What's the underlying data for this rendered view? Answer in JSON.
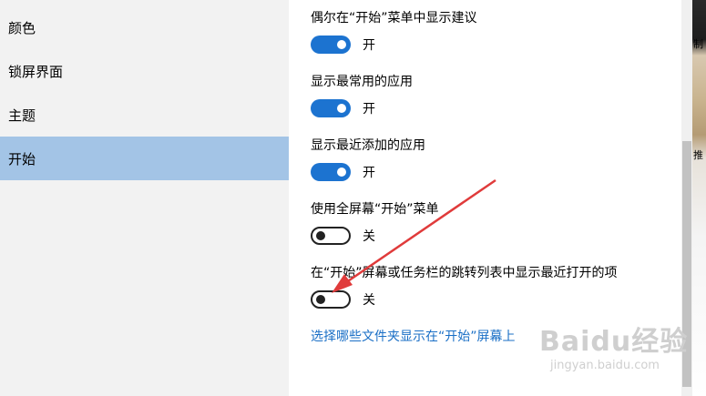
{
  "sidebar": {
    "items": [
      {
        "label": "颜色"
      },
      {
        "label": "锁屏界面"
      },
      {
        "label": "主题"
      },
      {
        "label": "开始"
      }
    ]
  },
  "settings": [
    {
      "label": "偶尔在“开始”菜单中显示建议",
      "state": "开"
    },
    {
      "label": "显示最常用的应用",
      "state": "开"
    },
    {
      "label": "显示最近添加的应用",
      "state": "开"
    },
    {
      "label": "使用全屏幕“开始”菜单",
      "state": "关"
    },
    {
      "label": "在“开始”屏幕或任务栏的跳转列表中显示最近打开的项",
      "state": "关"
    }
  ],
  "link": {
    "label": "选择哪些文件夹显示在“开始”屏幕上"
  },
  "side_strip": {
    "text1": "制",
    "text2": "推"
  },
  "watermark": {
    "main": "Baidu经验",
    "sub": "jingyan.baidu.com"
  },
  "colors": {
    "accent": "#1c73d0",
    "active_nav": "#a3c4e6",
    "link": "#1a6fc6",
    "arrow": "#e03b3b"
  }
}
